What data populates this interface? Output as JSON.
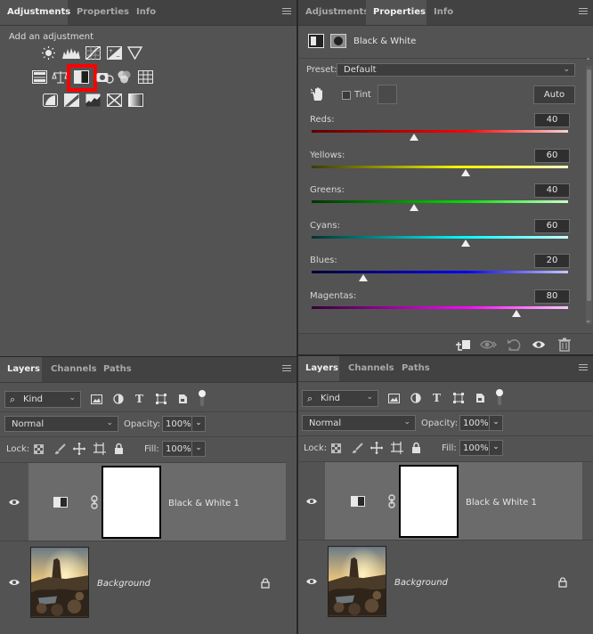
{
  "adjustments_panel": {
    "tabs": [
      "Adjustments",
      "Properties",
      "Info"
    ],
    "add_label": "Add an adjustment",
    "icons": {
      "row1": [
        "brightness-contrast-icon",
        "levels-icon",
        "curves-icon",
        "exposure-icon",
        "vibrance-icon"
      ],
      "row2": [
        "hue-saturation-icon",
        "color-balance-icon",
        "black-white-icon",
        "photo-filter-icon",
        "channel-mixer-icon",
        "color-lookup-icon"
      ],
      "row3": [
        "invert-icon",
        "posterize-icon",
        "threshold-icon",
        "selective-color-icon",
        "gradient-map-icon"
      ]
    },
    "highlight_color": "#ff0000"
  },
  "properties_panel": {
    "tabs": [
      "Adjustments",
      "Properties",
      "Info"
    ],
    "header": "Black & White",
    "preset_label": "Preset:",
    "preset_value": "Default",
    "tint_label": "Tint",
    "auto_label": "Auto",
    "sliders": [
      {
        "label": "Reds:",
        "value": "40",
        "fraction": 0.4,
        "from": "#5a0000",
        "to": "#ffd0d0",
        "mid": "#ff0000"
      },
      {
        "label": "Yellows:",
        "value": "60",
        "fraction": 0.6,
        "from": "#3b3b00",
        "to": "#ffffc0",
        "mid": "#ffff00"
      },
      {
        "label": "Greens:",
        "value": "40",
        "fraction": 0.4,
        "from": "#003300",
        "to": "#c8ffc8",
        "mid": "#00dd00"
      },
      {
        "label": "Cyans:",
        "value": "60",
        "fraction": 0.6,
        "from": "#003333",
        "to": "#c8ffff",
        "mid": "#00ffff"
      },
      {
        "label": "Blues:",
        "value": "20",
        "fraction": 0.2,
        "from": "#000033",
        "to": "#c8c8ff",
        "mid": "#0000ff"
      },
      {
        "label": "Magentas:",
        "value": "80",
        "fraction": 0.8,
        "from": "#330033",
        "to": "#ffc8ff",
        "mid": "#ff00ff"
      }
    ]
  },
  "layers_left": {
    "tabs": [
      "Layers",
      "Channels",
      "Paths"
    ],
    "kind_label": "Kind",
    "blend_mode": "Normal",
    "opacity_label": "Opacity:",
    "opacity_value": "100%",
    "lock_label": "Lock:",
    "fill_label": "Fill:",
    "fill_value": "100%",
    "layers": [
      {
        "name": "Black & White 1"
      },
      {
        "name": "Background"
      }
    ]
  },
  "layers_right": {
    "tabs": [
      "Layers",
      "Channels",
      "Paths"
    ],
    "kind_label": "Kind",
    "blend_mode": "Normal",
    "opacity_label": "Opacity:",
    "opacity_value": "100%",
    "lock_label": "Lock:",
    "fill_label": "Fill:",
    "fill_value": "100%",
    "layers": [
      {
        "name": "Black & White 1"
      },
      {
        "name": "Background"
      }
    ]
  }
}
